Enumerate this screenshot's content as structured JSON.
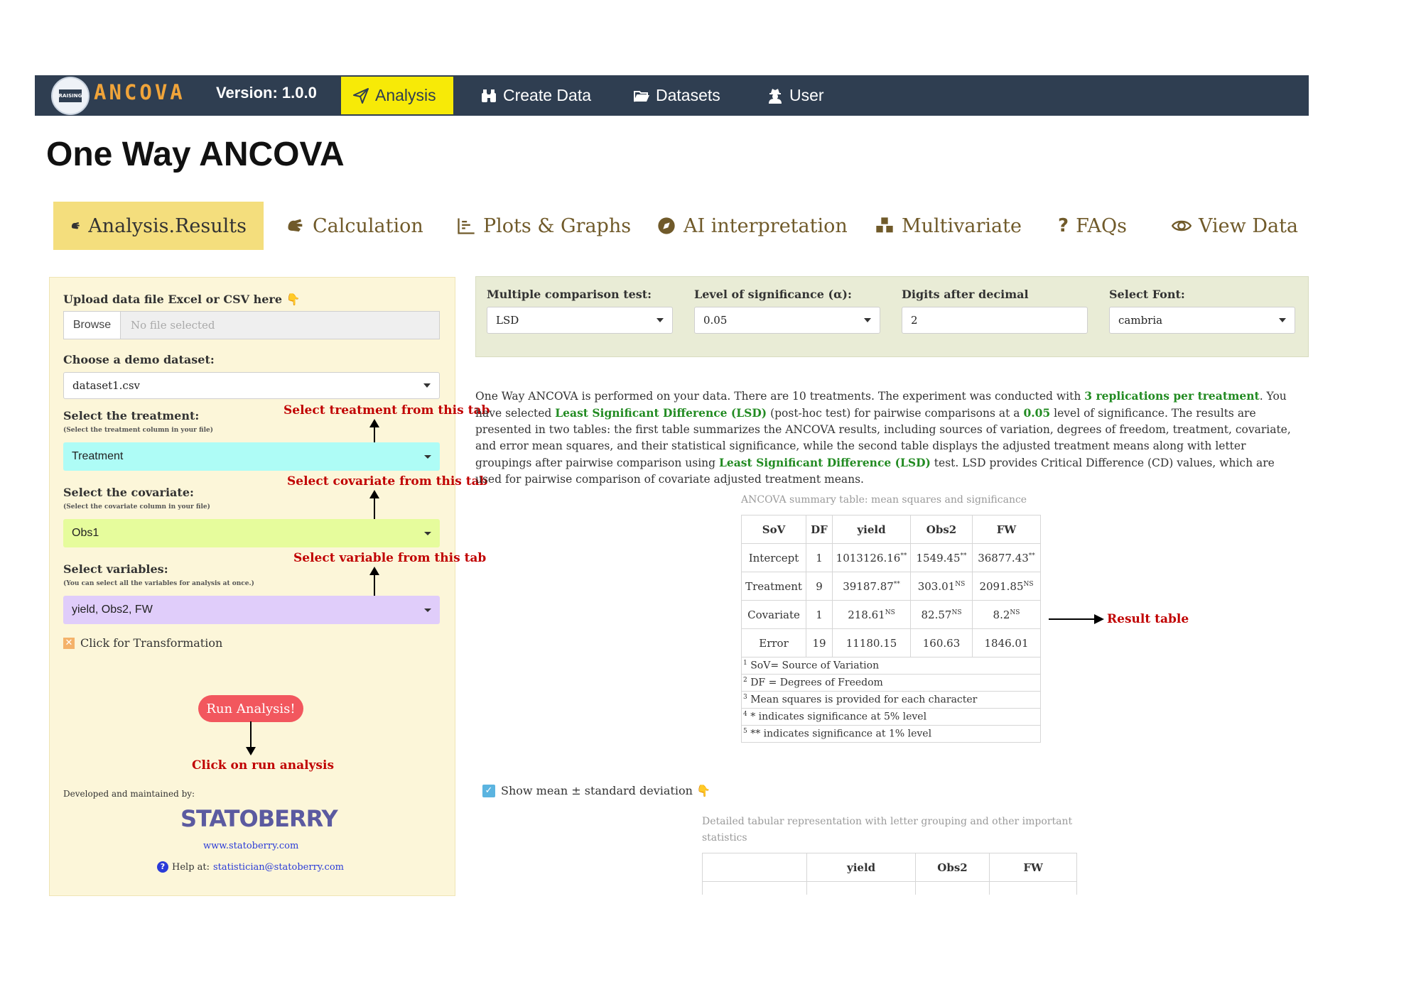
{
  "navbar": {
    "brand": "ANCOVA",
    "version": "Version: 1.0.0",
    "logo_text": "RAISING",
    "items": [
      {
        "label": "Analysis",
        "icon": "paper-plane-icon",
        "active": true
      },
      {
        "label": "Create Data",
        "icon": "binoculars-icon"
      },
      {
        "label": "Datasets",
        "icon": "folder-open-icon"
      },
      {
        "label": "User",
        "icon": "user-secret-icon"
      }
    ],
    "bg_color": "#2f3e51",
    "active_color": "#f7ea07"
  },
  "page_title": "One Way ANCOVA",
  "tabs": [
    {
      "label": "Analysis.Results",
      "icon": "sign-language-icon",
      "active": true
    },
    {
      "label": "Calculation",
      "icon": "sign-language-icon"
    },
    {
      "label": "Plots & Graphs",
      "icon": "bar-chart-icon"
    },
    {
      "label": "AI interpretation",
      "icon": "compass-icon"
    },
    {
      "label": "Multivariate",
      "icon": "cubes-icon"
    },
    {
      "label": "FAQs",
      "icon": "question-icon"
    },
    {
      "label": "View Data",
      "icon": "eye-icon"
    }
  ],
  "sidebar": {
    "upload_label": "Upload data file Excel or CSV here 👇",
    "browse_label": "Browse",
    "file_placeholder": "No file selected",
    "demo_label": "Choose a demo dataset:",
    "demo_value": "dataset1.csv",
    "treatment_label": "Select the treatment:",
    "treatment_hint": "(Select the treatment column in your file)",
    "treatment_value": "Treatment",
    "treatment_annotation": "Select treatment from this tab",
    "covariate_label": "Select the covariate:",
    "covariate_hint": "(Select the covariate column in your file)",
    "covariate_value": "Obs1",
    "covariate_annotation": "Select covariate from this tab",
    "variables_label": "Select variables:",
    "variables_hint": "(You can select all the variables for analysis at once.)",
    "variables_value": "yield, Obs2, FW",
    "variables_annotation": "Select variable from this tab",
    "transform_label": "Click for Transformation",
    "run_button": "Run Analysis!",
    "run_annotation": "Click on run analysis",
    "developed_by": "Developed and maintained by:",
    "company": "STATOBERRY",
    "website": "www.statoberry.com",
    "help_label": "Help at:",
    "help_email": "statistician@statoberry.com",
    "treatment_color": "#aefcf6",
    "covariate_color": "#e6fc9c",
    "variables_color": "#e0cdfa"
  },
  "settings": {
    "mct_label": "Multiple comparison test:",
    "mct_value": "LSD",
    "alpha_label": "Level of significance (α):",
    "alpha_value": "0.05",
    "digits_label": "Digits after decimal",
    "digits_value": "2",
    "font_label": "Select Font:",
    "font_value": "cambria"
  },
  "summary": {
    "p1": "One Way ANCOVA is performed on your data. There are 10 treatments. The experiment was conducted with ",
    "b1": "3 replications per treatment",
    "p2": ". You have selected ",
    "b2": "Least Significant Difference (LSD)",
    "p3": " (post-hoc test) for pairwise comparisons at a ",
    "b3": "0.05",
    "p4": " level of significance. The results are presented in two tables: the first table summarizes the ANCOVA results, including sources of variation, degrees of freedom, treatment, covariate, and error mean squares, and their statistical significance, while the second table displays the adjusted treatment means along with letter groupings after pairwise comparison using ",
    "b4": "Least Significant Difference (LSD)",
    "p5": " test. LSD provides Critical Difference (CD) values, which are used for pairwise comparison of covariate adjusted treatment means."
  },
  "anova_table": {
    "caption": "ANCOVA summary table: mean squares and significance",
    "headers": [
      "SoV",
      "DF",
      "yield",
      "Obs2",
      "FW"
    ],
    "rows": [
      {
        "sov": "Intercept",
        "df": "1",
        "yield": "1013126.16",
        "yield_sig": "**",
        "obs2": "1549.45",
        "obs2_sig": "**",
        "fw": "36877.43",
        "fw_sig": "**"
      },
      {
        "sov": "Treatment",
        "df": "9",
        "yield": "39187.87",
        "yield_sig": "**",
        "obs2": "303.01",
        "obs2_sig": "NS",
        "fw": "2091.85",
        "fw_sig": "NS"
      },
      {
        "sov": "Covariate",
        "df": "1",
        "yield": "218.61",
        "yield_sig": "NS",
        "obs2": "82.57",
        "obs2_sig": "NS",
        "fw": "8.2",
        "fw_sig": "NS"
      },
      {
        "sov": "Error",
        "df": "19",
        "yield": "11180.15",
        "yield_sig": "",
        "obs2": "160.63",
        "obs2_sig": "",
        "fw": "1846.01",
        "fw_sig": ""
      }
    ],
    "notes": [
      {
        "n": "1",
        "text": "SoV= Source of Variation"
      },
      {
        "n": "2",
        "text": "DF = Degrees of Freedom"
      },
      {
        "n": "3",
        "text": "Mean squares is provided for each character"
      },
      {
        "n": "4",
        "text": "* indicates significance at 5% level"
      },
      {
        "n": "5",
        "text": "** indicates significance at 1% level"
      }
    ],
    "annotation": "Result table"
  },
  "show_mean_label": "Show mean ± standard deviation 👇",
  "detail_table": {
    "caption": "Detailed tabular representation with letter grouping and other important statistics",
    "headers": [
      "",
      "yield",
      "Obs2",
      "FW"
    ]
  }
}
